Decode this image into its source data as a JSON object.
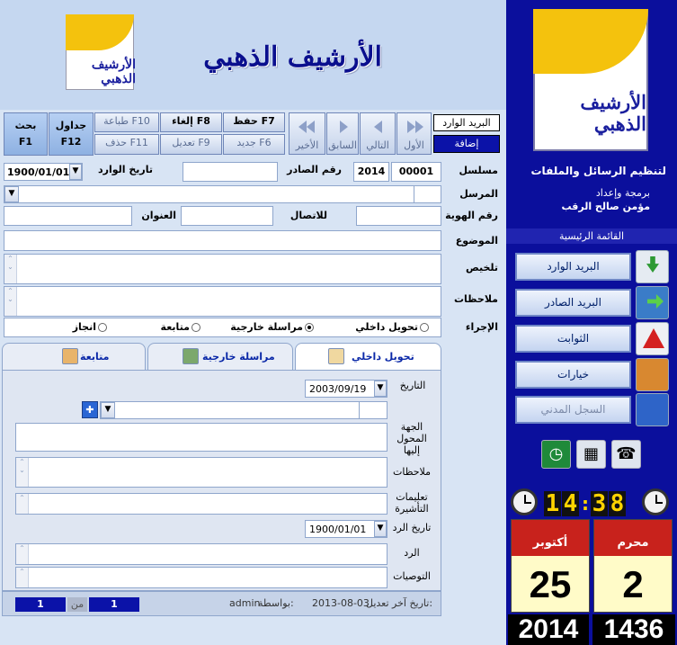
{
  "header": {
    "title": "الأرشيف الذهبي",
    "logo_text": "الأرشيف الذهبي"
  },
  "toolbar": {
    "mail_in": "البريد الوارد",
    "add": "إضافة",
    "first": "الأول",
    "next": "التالي",
    "prev": "السابق",
    "last": "الأخير",
    "save": "حفظ F7",
    "new": "جديد F6",
    "cancel": "إلغاء F8",
    "edit": "تعديل F9",
    "print": "طباعة F10",
    "delete": "حذف F11",
    "tables": "جداول",
    "tables_key": "F12",
    "search": "بحث",
    "search_key": "F1"
  },
  "form": {
    "serial_label": "مسلسل",
    "serial": "00001",
    "year": "2014",
    "outgoing_no_label": "رقم الصادر",
    "incoming_date_label": "تاريخ الوارد",
    "incoming_date": "1900/01/01",
    "sender_label": "المرسل",
    "id_label": "رقم الهوية",
    "contact_label": "للاتصال",
    "address_label": "العنوان",
    "subject_label": "الموضوع",
    "summary_label": "تلخيص",
    "notes_label": "ملاحظات",
    "action_label": "الإجراء",
    "actions": [
      "تحويل داخلي",
      "مراسلة خارجية",
      "متابعة",
      "انجاز"
    ],
    "selected_action": "مراسلة خارجية"
  },
  "tabs": [
    "تحويل داخلي",
    "مراسلة خارجية",
    "متابعة"
  ],
  "tab_panel": {
    "date_label": "التاريخ",
    "date": "2003/09/19",
    "dept_label": "الجهة المحول إليها",
    "notes_label": "ملاحظات",
    "instructions_label": "تعليمات التأشيرة",
    "reply_date_label": "تاريخ الرد",
    "reply_date": "1900/01/01",
    "reply_label": "الرد",
    "recommendations_label": "التوصيات"
  },
  "status": {
    "record": "1",
    "of": "من",
    "total": "1",
    "by_label": "بواسطة:",
    "user": "admin",
    "last_edit_label": "تاريخ آخر تعديل:",
    "last_edit": "2013-08-03"
  },
  "side": {
    "tagline": "لتنظيم الرسائل والملفات",
    "credit_line": "برمجة وإعداد",
    "author": "مؤمن صالح الرقب",
    "menu_title": "القائمة الرئيسية",
    "menu": [
      "البريد الوارد",
      "البريد الصادر",
      "الثوابت",
      "خيارات",
      "السجل المدني"
    ],
    "time_h": "14",
    "time_m": "38",
    "hijri_month": "محرم",
    "hijri_day": "2",
    "greg_month": "أكتوبر",
    "greg_day": "25",
    "hijri_year": "1436",
    "greg_year": "2014"
  }
}
